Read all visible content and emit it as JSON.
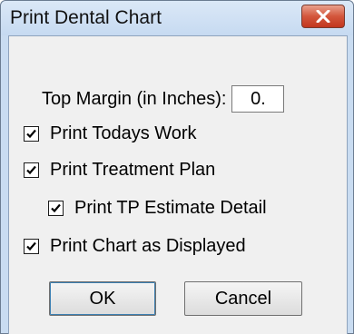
{
  "window": {
    "title": "Print Dental Chart",
    "close_icon": "close-x-icon"
  },
  "top_margin": {
    "label": "Top Margin (in Inches):",
    "value": "0."
  },
  "options": [
    {
      "label": "Print Todays Work",
      "checked": true
    },
    {
      "label": "Print Treatment Plan",
      "checked": true
    },
    {
      "label": "Print TP Estimate Detail",
      "checked": true
    },
    {
      "label": "Print Chart as Displayed",
      "checked": true
    }
  ],
  "buttons": {
    "ok": "OK",
    "cancel": "Cancel"
  },
  "colors": {
    "title_bar": "#c9dcf1",
    "client_area": "#f0f0f0",
    "close_button": "#c7452a"
  }
}
